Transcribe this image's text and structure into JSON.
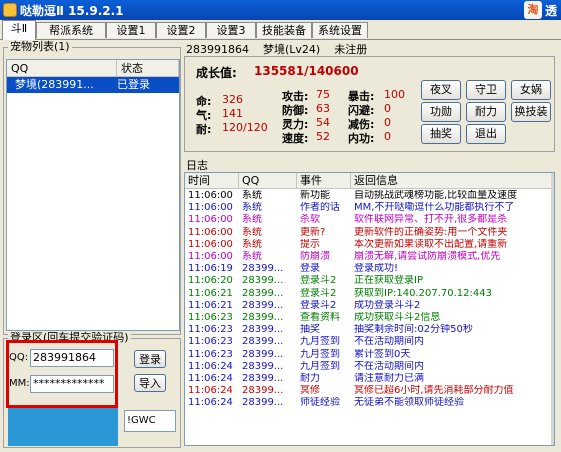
{
  "window": {
    "title": "哒勒逗Ⅱ  15.9.2.1",
    "brand_icon": "淘",
    "brand_text": "透"
  },
  "tabs": [
    "斗Ⅱ",
    "帮派系统",
    "设置1",
    "设置2",
    "设置3",
    "技能装备",
    "系统设置"
  ],
  "pet_list": {
    "title": "宠物列表(1)",
    "columns": [
      "QQ",
      "状态"
    ],
    "rows": [
      {
        "qq": "梦境(283991...",
        "status": "已登录"
      }
    ]
  },
  "login": {
    "title": "登录区(回车提交验证码)",
    "qq_label": "QQ:",
    "qq_value": "283991864",
    "pw_label": "MM:",
    "pw_value": "*************",
    "login_button": "登录",
    "import_button": "导入",
    "captcha_value": "!GWC"
  },
  "account": {
    "qq": "283991864",
    "name": "梦境(Lv24)",
    "status": "未注册"
  },
  "stats": {
    "growth_label": "成长值:",
    "growth_value": "135581/140600",
    "ming_label": "命:",
    "ming": "326",
    "qi_label": "气:",
    "qi": "141",
    "nai_label": "耐:",
    "nai": "120/120",
    "attack_label": "攻击:",
    "attack": "75",
    "defense_label": "防御:",
    "defense": "63",
    "spirit_label": "灵力:",
    "spirit": "54",
    "speed_label": "速度:",
    "speed": "52",
    "crit_label": "暴击:",
    "crit": "100",
    "dodge_label": "闪避:",
    "dodge": "0",
    "reduce_label": "减伤:",
    "reduce": "0",
    "inner_label": "内功:",
    "inner": "0"
  },
  "action_buttons": [
    "夜叉",
    "守卫",
    "女娲",
    "功勋",
    "耐力",
    "换技装",
    "抽奖",
    "退出"
  ],
  "log": {
    "title": "日志",
    "columns": [
      "时间",
      "QQ",
      "事件",
      "返回信息"
    ],
    "colors": {
      "black": "#000000",
      "blue": "#1414c8",
      "red": "#c80000",
      "green": "#008000",
      "purple": "#c000c0"
    },
    "rows": [
      {
        "time": "11:06:00",
        "qq": "系统",
        "event": "新功能",
        "msg": "自动挑战武魂榜功能,比较血量及速度",
        "color": "black"
      },
      {
        "time": "11:06:00",
        "qq": "系统",
        "event": "作者的话",
        "msg": "MM,不开哒嘞逗什么功能都执行不了",
        "color": "blue"
      },
      {
        "time": "11:06:00",
        "qq": "系统",
        "event": "杀软",
        "msg": "软件联网异常、打不开,很多都是杀",
        "color": "purple"
      },
      {
        "time": "11:06:00",
        "qq": "系统",
        "event": "更新?",
        "msg": "更新软件的正确姿势:用一个文件夹",
        "color": "red"
      },
      {
        "time": "11:06:00",
        "qq": "系统",
        "event": "提示",
        "msg": "本次更新如果读取不出配置,请重新",
        "color": "red"
      },
      {
        "time": "11:06:00",
        "qq": "系统",
        "event": "防崩溃",
        "msg": "崩溃无解,请尝试防崩溃模式,优先",
        "color": "purple"
      },
      {
        "time": "11:06:19",
        "qq": "28399...",
        "event": "登录",
        "msg": "登录成功!",
        "color": "blue"
      },
      {
        "time": "11:06:20",
        "qq": "28399...",
        "event": "登录斗2",
        "msg": "正在获取登录IP",
        "color": "green"
      },
      {
        "time": "11:06:21",
        "qq": "28399...",
        "event": "登录斗2",
        "msg": "获取到IP:140.207.70.12:443",
        "color": "green"
      },
      {
        "time": "11:06:21",
        "qq": "28399...",
        "event": "登录斗2",
        "msg": "成功登录斗斗2",
        "color": "blue"
      },
      {
        "time": "11:06:23",
        "qq": "28399...",
        "event": "查看资料",
        "msg": "成功获取斗斗2信息",
        "color": "green"
      },
      {
        "time": "11:06:23",
        "qq": "28399...",
        "event": "抽奖",
        "msg": "抽奖剩余时间:02分钟50秒",
        "color": "blue"
      },
      {
        "time": "11:06:23",
        "qq": "28399...",
        "event": "九月签到",
        "msg": "不在活动期间内",
        "color": "blue"
      },
      {
        "time": "11:06:23",
        "qq": "28399...",
        "event": "九月签到",
        "msg": "累计签到0天",
        "color": "blue"
      },
      {
        "time": "11:06:24",
        "qq": "28399...",
        "event": "九月签到",
        "msg": "不在活动期间内",
        "color": "blue"
      },
      {
        "time": "11:06:24",
        "qq": "28399...",
        "event": "耐力",
        "msg": "请注意耐力已满",
        "color": "blue"
      },
      {
        "time": "11:06:24",
        "qq": "28399...",
        "event": "冥修",
        "msg": "冥修已超6小时,请先消耗部分耐力值",
        "color": "red"
      },
      {
        "time": "11:06:24",
        "qq": "28399...",
        "event": "师徒经验",
        "msg": "无徒弟不能领取师徒经验",
        "color": "blue"
      }
    ]
  }
}
